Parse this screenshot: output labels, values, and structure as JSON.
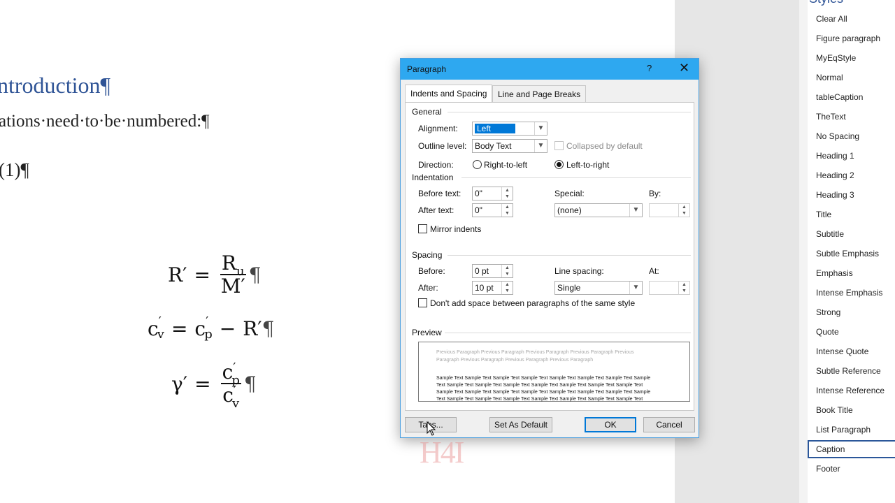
{
  "document": {
    "heading": "ntroduction¶",
    "body_line": "ations·need·to·be·numbered:¶",
    "eq_number": "(1)¶",
    "equations": {
      "eq1": {
        "lhs": "R′",
        "eq": "=",
        "num_base": "R",
        "num_sub": "u",
        "den": "M′",
        "mark": "¶"
      },
      "eq2": {
        "lhs_base": "c",
        "lhs_sup": "′",
        "lhs_sub": "v",
        "eq": "=",
        "r1_base": "c",
        "r1_sup": "′",
        "r1_sub": "p",
        "minus": "−",
        "r2": "R′",
        "mark": "¶"
      },
      "eq3": {
        "lhs": "γ′",
        "eq": "=",
        "num_base": "c",
        "num_sup": "′",
        "num_sub": "p",
        "den_base": "c",
        "den_sup": "′",
        "den_sub": "v",
        "mark": "¶"
      }
    }
  },
  "styles_pane": {
    "title": "Styles",
    "items": [
      "Clear All",
      "Figure paragraph",
      "MyEqStyle",
      "Normal",
      "tableCaption",
      "TheText",
      "No Spacing",
      "Heading 1",
      "Heading 2",
      "Heading 3",
      "Title",
      "Subtitle",
      "Subtle Emphasis",
      "Emphasis",
      "Intense Emphasis",
      "Strong",
      "Quote",
      "Intense Quote",
      "Subtle Reference",
      "Intense Reference",
      "Book Title",
      "List Paragraph",
      "Caption",
      "Footer"
    ],
    "selected": "Caption",
    "accent_color": "#2b579a"
  },
  "dialog": {
    "title": "Paragraph",
    "help": "?",
    "close": "✕",
    "tabs": [
      {
        "label": "Indents and Spacing",
        "active": true
      },
      {
        "label": "Line and Page Breaks",
        "active": false
      }
    ],
    "general": {
      "header": "General",
      "alignment_label": "Alignment:",
      "alignment_value": "Left",
      "outline_label": "Outline level:",
      "outline_value": "Body Text",
      "collapsed_label": "Collapsed by default",
      "direction_label": "Direction:",
      "rtl_label": "Right-to-left",
      "ltr_label": "Left-to-right"
    },
    "indentation": {
      "header": "Indentation",
      "before_label": "Before text:",
      "before_value": "0\"",
      "after_label": "After text:",
      "after_value": "0\"",
      "special_label": "Special:",
      "special_value": "(none)",
      "by_label": "By:",
      "by_value": "",
      "mirror_label": "Mirror indents"
    },
    "spacing": {
      "header": "Spacing",
      "before_label": "Before:",
      "before_value": "0 pt",
      "after_label": "After:",
      "after_value": "10 pt",
      "line_label": "Line spacing:",
      "line_value": "Single",
      "at_label": "At:",
      "at_value": "",
      "dont_add_label": "Don't add space between paragraphs of the same style"
    },
    "preview": {
      "header": "Preview",
      "previous_text": "Previous Paragraph Previous Paragraph Previous Paragraph Previous Paragraph Previous Paragraph Previous Paragraph Previous Paragraph Previous Paragraph",
      "sample_text": "Sample Text Sample Text Sample Text Sample Text Sample Text Sample Text Sample Text Sample Text Sample Text Sample Text Sample Text Sample Text Sample Text Sample Text Sample Text Sample Text Sample Text Sample Text Sample Text Sample Text Sample Text Sample Text Sample Text Sample Text Sample Text Sample Text Sample Text Sample Text Sample Text Sample Text"
    },
    "buttons": {
      "tabs": "Tabs...",
      "set_default": "Set As Default",
      "ok": "OK",
      "cancel": "Cancel"
    },
    "titlebar_color": "#2ea8f0"
  },
  "watermark": "H4I"
}
